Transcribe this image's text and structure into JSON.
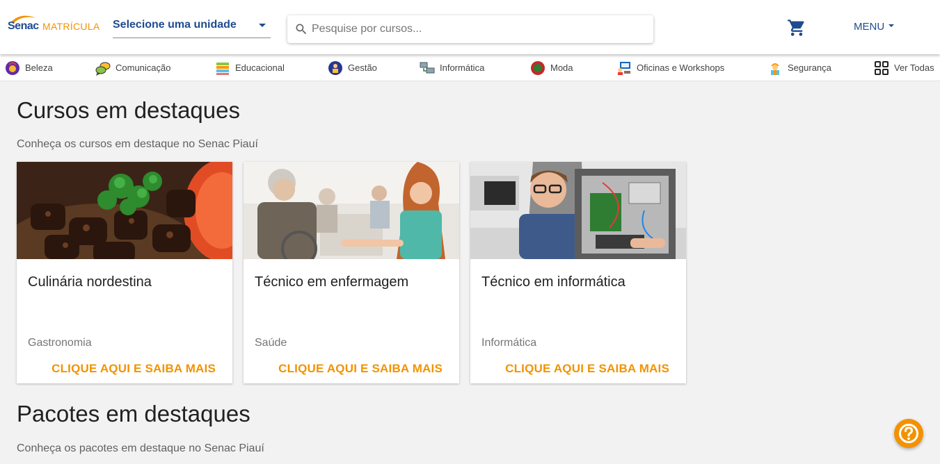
{
  "header": {
    "logo_brand": "Senac",
    "logo_product": "MATRÍCULA",
    "unit_select_label": "Selecione uma unidade",
    "search_placeholder": "Pesquise por cursos...",
    "menu_label": "MENU",
    "brand_color": "#1e4b8f",
    "accent_color": "#f39200"
  },
  "categories": [
    {
      "label": "Beleza",
      "icon": "beauty-icon"
    },
    {
      "label": "Comunicação",
      "icon": "chat-bubbles-icon"
    },
    {
      "label": "Educacional",
      "icon": "books-icon"
    },
    {
      "label": "Gestão",
      "icon": "management-icon"
    },
    {
      "label": "Informática",
      "icon": "computers-icon"
    },
    {
      "label": "Moda",
      "icon": "fashion-icon"
    },
    {
      "label": "Oficinas e Workshops",
      "icon": "workshop-icon"
    },
    {
      "label": "Segurança",
      "icon": "safety-worker-icon"
    },
    {
      "label": "Ver Todas",
      "icon": "grid-icon"
    }
  ],
  "featured_courses": {
    "title": "Cursos em destaques",
    "subtitle": "Conheça os cursos em destaque no Senac Piauí",
    "cards": [
      {
        "title": "Culinária nordestina",
        "category": "Gastronomia",
        "cta": "CLIQUE AQUI E SAIBA MAIS",
        "image": "grilled-meat-image"
      },
      {
        "title": "Técnico em enfermagem",
        "category": "Saúde",
        "cta": "CLIQUE AQUI E SAIBA MAIS",
        "image": "nurse-elderly-image"
      },
      {
        "title": "Técnico em informática",
        "category": "Informática",
        "cta": "CLIQUE AQUI E SAIBA MAIS",
        "image": "computer-technician-image"
      }
    ]
  },
  "featured_packages": {
    "title": "Pacotes em destaques",
    "subtitle": "Conheça os pacotes em destaque no Senac Piauí"
  },
  "help_button": {
    "icon": "question-mark-icon"
  }
}
